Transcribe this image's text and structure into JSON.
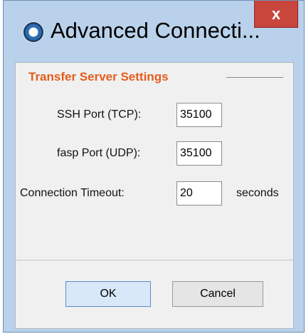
{
  "window": {
    "title": "Advanced Connecti...",
    "close_label": "x"
  },
  "section": {
    "title": "Transfer Server Settings"
  },
  "fields": {
    "ssh_port": {
      "label": "SSH Port (TCP):",
      "value": "35100"
    },
    "fasp_port": {
      "label": "fasp Port (UDP):",
      "value": "35100"
    },
    "timeout": {
      "label": "Connection Timeout:",
      "value": "20",
      "unit": "seconds"
    }
  },
  "buttons": {
    "ok": "OK",
    "cancel": "Cancel"
  },
  "colors": {
    "title_bar": "#b9d1ea",
    "close_button": "#c9463d",
    "section_title": "#e35d1c",
    "panel": "#f0f0f0"
  },
  "icons": {
    "app": "app-icon",
    "close": "close-icon"
  }
}
